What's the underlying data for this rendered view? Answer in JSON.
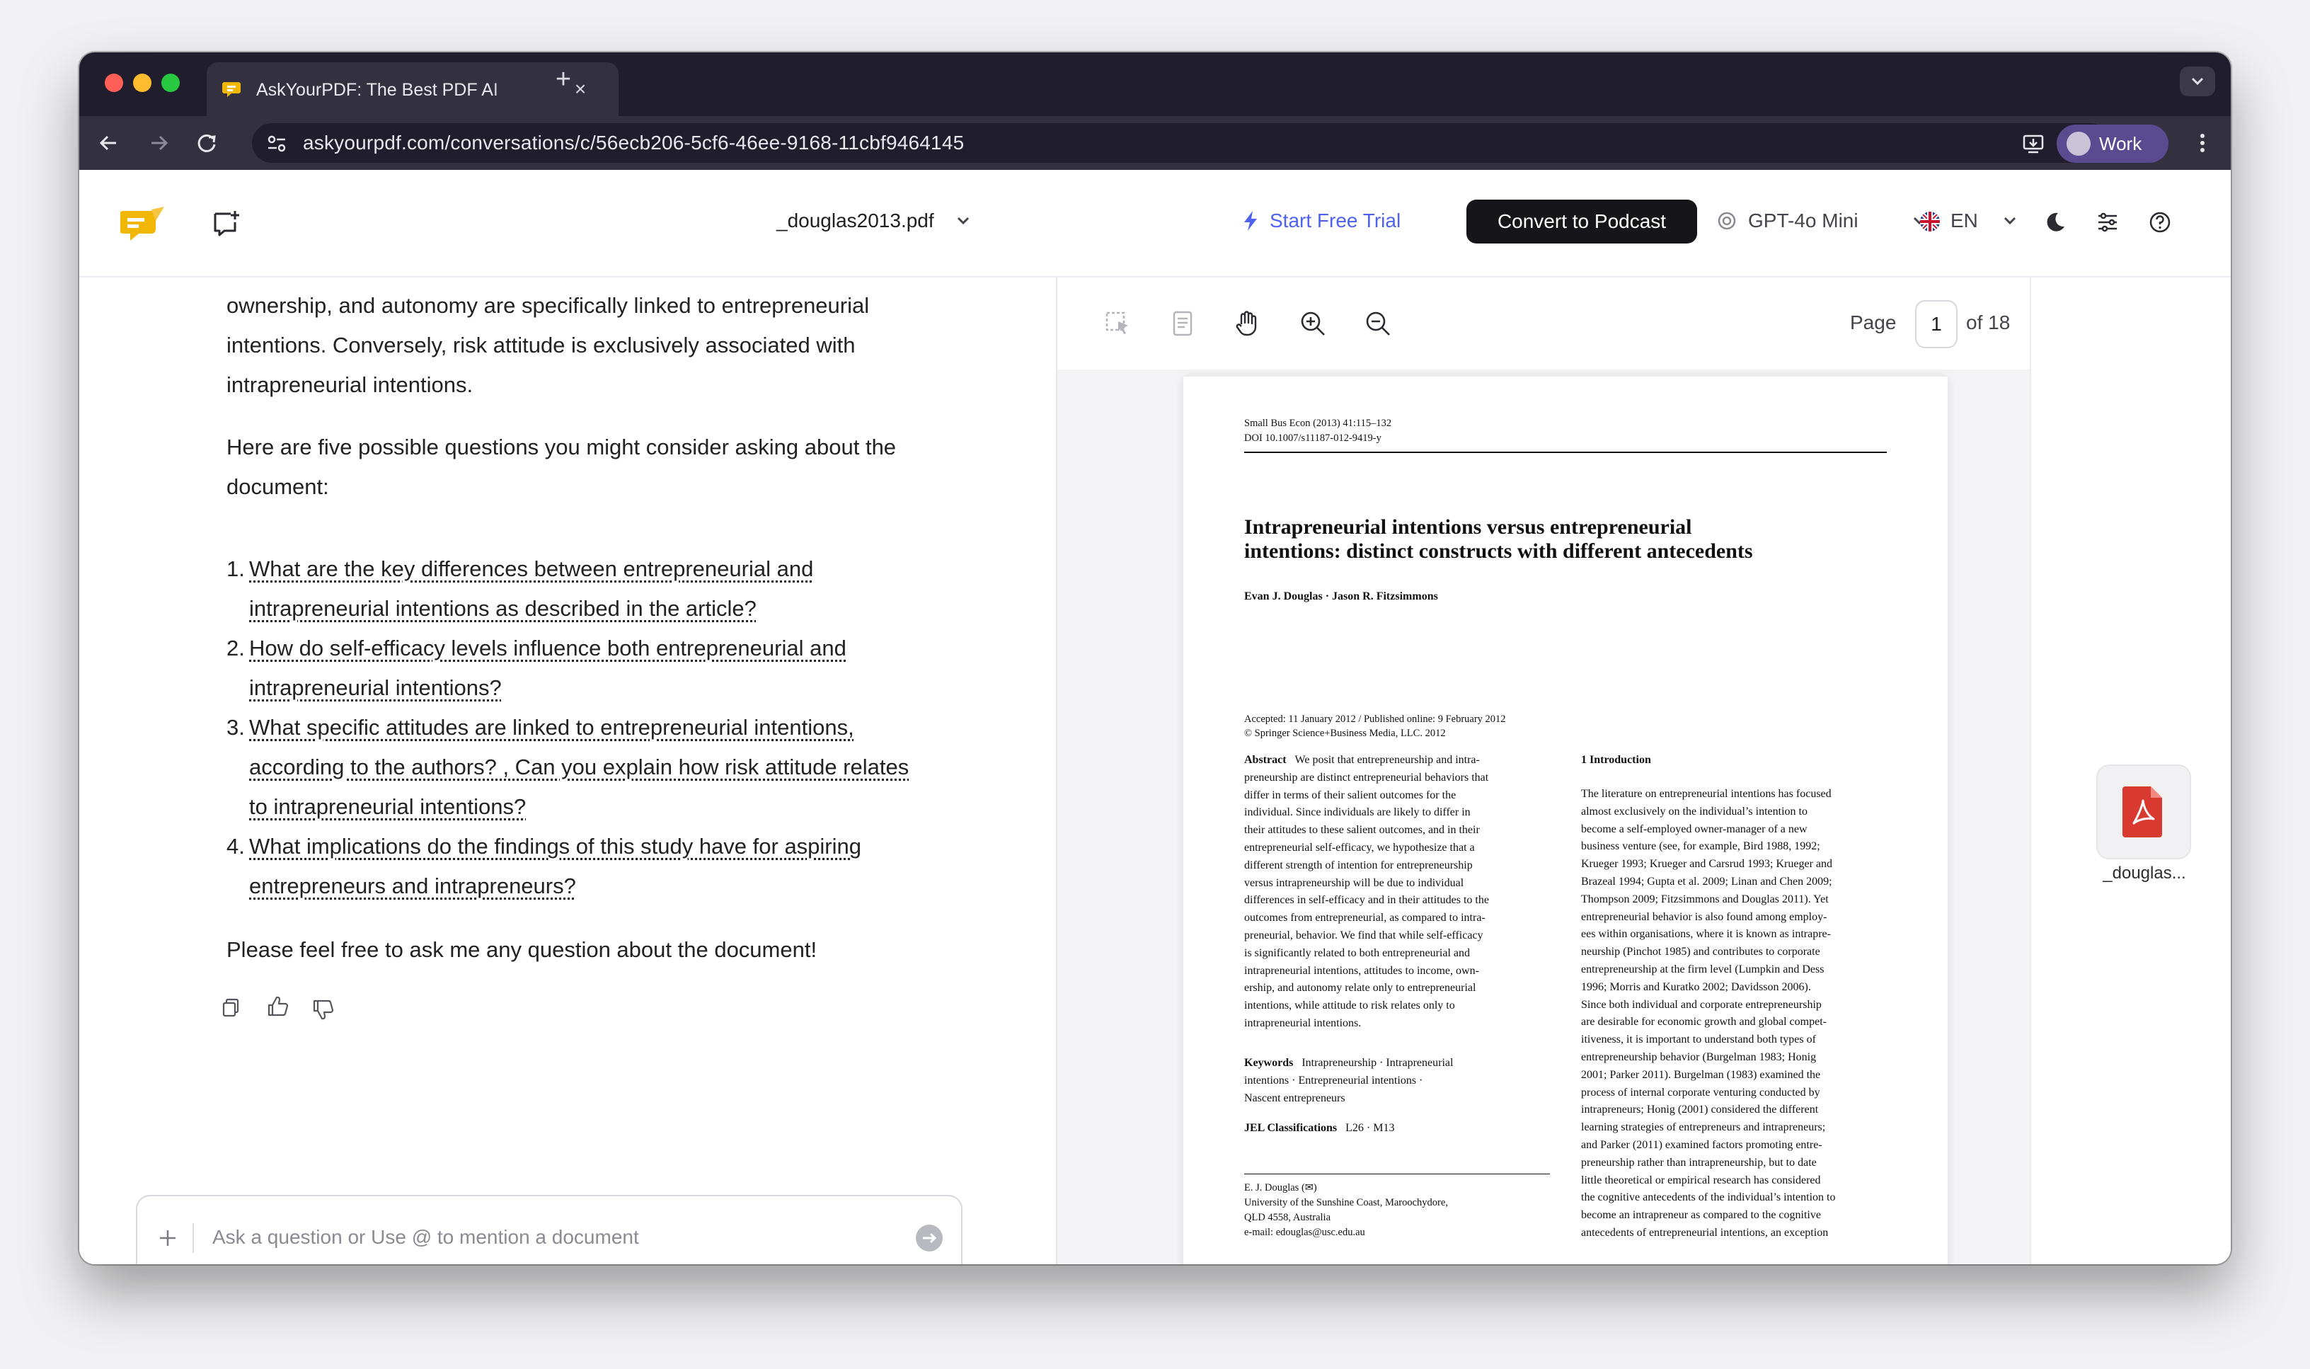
{
  "browser": {
    "tab_title": "AskYourPDF: The Best PDF AI",
    "url": "askyourpdf.com/conversations/c/56ecb206-5cf6-46ee-9168-11cbf9464145",
    "profile": "Work",
    "colors": {
      "chrome_dark": "#201e2d",
      "tab_active": "#33313f",
      "profile": "#5a4a8f"
    }
  },
  "header": {
    "document": "_douglas2013.pdf",
    "start_trial": "Start Free Trial",
    "convert": "Convert to Podcast",
    "model": "GPT-4o Mini",
    "language": "EN",
    "accent": "#4d63f0"
  },
  "chat": {
    "intro_lines": [
      "ownership, and autonomy are specifically linked to entrepreneurial",
      "intentions. Conversely, risk attitude is exclusively associated with",
      "intrapreneurial intentions."
    ],
    "lead_lines": [
      "Here are five possible questions you might consider asking about the",
      "document:"
    ],
    "questions": [
      {
        "num": "1.",
        "lines": [
          "What are the key differences between entrepreneurial and",
          "intrapreneurial intentions as described in the article?"
        ]
      },
      {
        "num": "2.",
        "lines": [
          "How do self-efficacy levels influence both entrepreneurial and",
          "intrapreneurial intentions?"
        ]
      },
      {
        "num": "3.",
        "lines": [
          "What specific attitudes are linked to entrepreneurial intentions,",
          "according to the authors? , Can you explain how risk attitude relates",
          "to intrapreneurial intentions?"
        ]
      },
      {
        "num": "4.",
        "lines": [
          "What implications do the findings of this study have for aspiring",
          "entrepreneurs and intrapreneurs?"
        ]
      }
    ],
    "closing": "Please feel free to ask me any question about the document!",
    "composer_placeholder": "Ask a question or Use @ to mention a document"
  },
  "viewer": {
    "page_label": "Page",
    "page": "1",
    "of_label": "of 18"
  },
  "pdf": {
    "journal": "Small Bus Econ (2013) 41:115–132",
    "doi": "DOI 10.1007/s11187-012-9419-y",
    "title_lines": [
      "Intrapreneurial intentions versus entrepreneurial",
      "intentions: distinct constructs with different antecedents"
    ],
    "authors": "Evan J. Douglas · Jason R. Fitzsimmons",
    "accepted": "Accepted: 11 January 2012 / Published online: 9 February 2012",
    "copyright": "© Springer Science+Business Media, LLC. 2012",
    "abstract_label": "Abstract",
    "abstract_lines": [
      "We posit that entrepreneurship and intra-",
      "preneurship are distinct entrepreneurial behaviors that",
      "differ in terms of their salient outcomes for the",
      "individual. Since individuals are likely to differ in",
      "their attitudes to these salient outcomes, and in their",
      "entrepreneurial self-efficacy, we hypothesize that a",
      "different strength of intention for entrepreneurship",
      "versus intrapreneurship will be due to individual",
      "differences in self-efficacy and in their attitudes to the",
      "outcomes from entrepreneurial, as compared to intra-",
      "preneurial, behavior. We find that while self-efficacy",
      "is significantly related to both entrepreneurial and",
      "intrapreneurial intentions, attitudes to income, own-",
      "ership, and autonomy relate only to entrepreneurial",
      "intentions, while attitude to risk relates only to",
      "intrapreneurial intentions."
    ],
    "keywords_label": "Keywords",
    "keywords_lines": [
      "Intrapreneurship · Intrapreneurial",
      "intentions · Entrepreneurial intentions ·",
      "Nascent entrepreneurs"
    ],
    "jel_label": "JEL Classifications",
    "jel": "L26 · M13",
    "affil_lines": [
      "E. J. Douglas (✉)",
      "University of the Sunshine Coast, Maroochydore,",
      "QLD 4558, Australia",
      "e-mail: edouglas@usc.edu.au"
    ],
    "intro_heading": "1  Introduction",
    "intro_lines": [
      "The literature on entrepreneurial intentions has focused",
      "almost exclusively on the individual’s intention to",
      "become a self-employed owner-manager of a new",
      "business venture (see, for example, Bird 1988, 1992;",
      "Krueger 1993; Krueger and Carsrud 1993; Krueger and",
      "Brazeal 1994; Gupta et al. 2009; Linan and Chen 2009;",
      "Thompson 2009; Fitzsimmons and Douglas 2011). Yet",
      "entrepreneurial behavior is also found among employ-",
      "ees within organisations, where it is known as intrapre-",
      "neurship (Pinchot 1985) and contributes to corporate",
      "entrepreneurship at the firm level (Lumpkin and Dess",
      "1996; Morris and Kuratko 2002; Davidsson 2006).",
      "Since both individual and corporate entrepreneurship",
      "are desirable for economic growth and global compet-",
      "itiveness, it is important to understand both types of",
      "entrepreneurship behavior (Burgelman 1983; Honig",
      "2001; Parker 2011). Burgelman (1983) examined the",
      "process of internal corporate venturing conducted by",
      "intrapreneurs; Honig (2001) considered the different",
      "learning strategies of entrepreneurs and intrapreneurs;",
      "and Parker (2011) examined factors promoting entre-",
      "preneurship rather than intrapreneurship, but to date",
      "little theoretical or empirical research has considered",
      "the cognitive antecedents of the individual’s intention to",
      "become an intrapreneur as compared to the cognitive",
      "antecedents of entrepreneurial intentions, an exception"
    ]
  },
  "dock": {
    "file_label": "_douglas..."
  }
}
